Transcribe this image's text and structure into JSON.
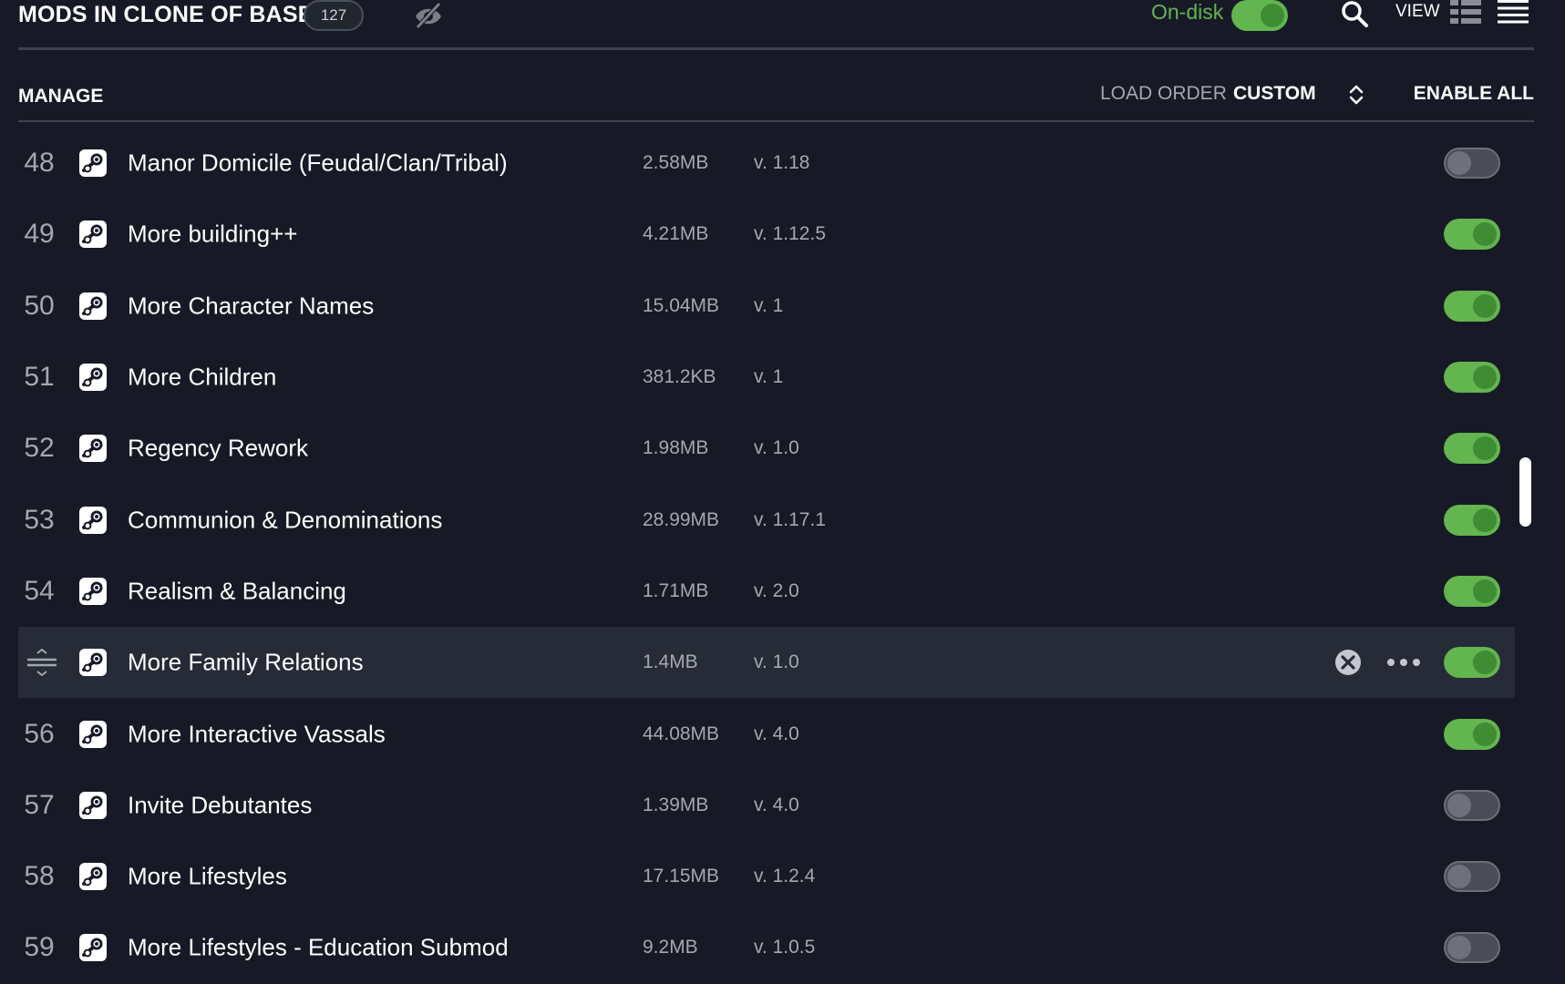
{
  "header": {
    "title": "MODS IN CLONE OF BASE",
    "mod_count": "127",
    "on_disk_label": "On-disk",
    "on_disk_enabled": true,
    "view_label": "VIEW"
  },
  "manage_bar": {
    "manage_label": "MANAGE",
    "load_order_label": "LOAD ORDER",
    "load_order_value": "CUSTOM",
    "enable_all_label": "ENABLE ALL"
  },
  "colors": {
    "accent_green": "#62b54f",
    "background": "#171a26",
    "selected_row": "#272b38",
    "muted_text": "#a3a7b1"
  },
  "mods": [
    {
      "num": "48",
      "name": "Manor Domicile (Feudal/Clan/Tribal)",
      "size": "2.58MB",
      "version": "v. 1.18",
      "enabled": false
    },
    {
      "num": "49",
      "name": "More building++",
      "size": "4.21MB",
      "version": "v. 1.12.5",
      "enabled": true
    },
    {
      "num": "50",
      "name": "More Character Names",
      "size": "15.04MB",
      "version": "v. 1",
      "enabled": true
    },
    {
      "num": "51",
      "name": "More Children",
      "size": "381.2KB",
      "version": "v. 1",
      "enabled": true
    },
    {
      "num": "52",
      "name": "Regency Rework",
      "size": "1.98MB",
      "version": "v. 1.0",
      "enabled": true
    },
    {
      "num": "53",
      "name": "Communion & Denominations",
      "size": "28.99MB",
      "version": "v. 1.17.1",
      "enabled": true
    },
    {
      "num": "54",
      "name": "Realism & Balancing",
      "size": "1.71MB",
      "version": "v. 2.0",
      "enabled": true
    },
    {
      "num": "",
      "name": "More Family Relations",
      "size": "1.4MB",
      "version": "v. 1.0",
      "enabled": true,
      "selected": true
    },
    {
      "num": "56",
      "name": "More Interactive Vassals",
      "size": "44.08MB",
      "version": "v. 4.0",
      "enabled": true
    },
    {
      "num": "57",
      "name": "Invite Debutantes",
      "size": "1.39MB",
      "version": "v. 4.0",
      "enabled": false
    },
    {
      "num": "58",
      "name": "More Lifestyles",
      "size": "17.15MB",
      "version": "v. 1.2.4",
      "enabled": false
    },
    {
      "num": "59",
      "name": "More Lifestyles - Education Submod",
      "size": "9.2MB",
      "version": "v. 1.0.5",
      "enabled": false
    }
  ],
  "icons": {
    "source_icon": "steam-icon",
    "hidden_icon": "eye-slash-icon",
    "search_icon": "search-icon",
    "grid_view_icon": "grid-view-icon",
    "list_view_icon": "list-view-icon",
    "sort_icon": "sort-icon",
    "remove_icon": "remove-icon",
    "more_icon": "more-icon",
    "drag_icon": "drag-handle-icon"
  }
}
